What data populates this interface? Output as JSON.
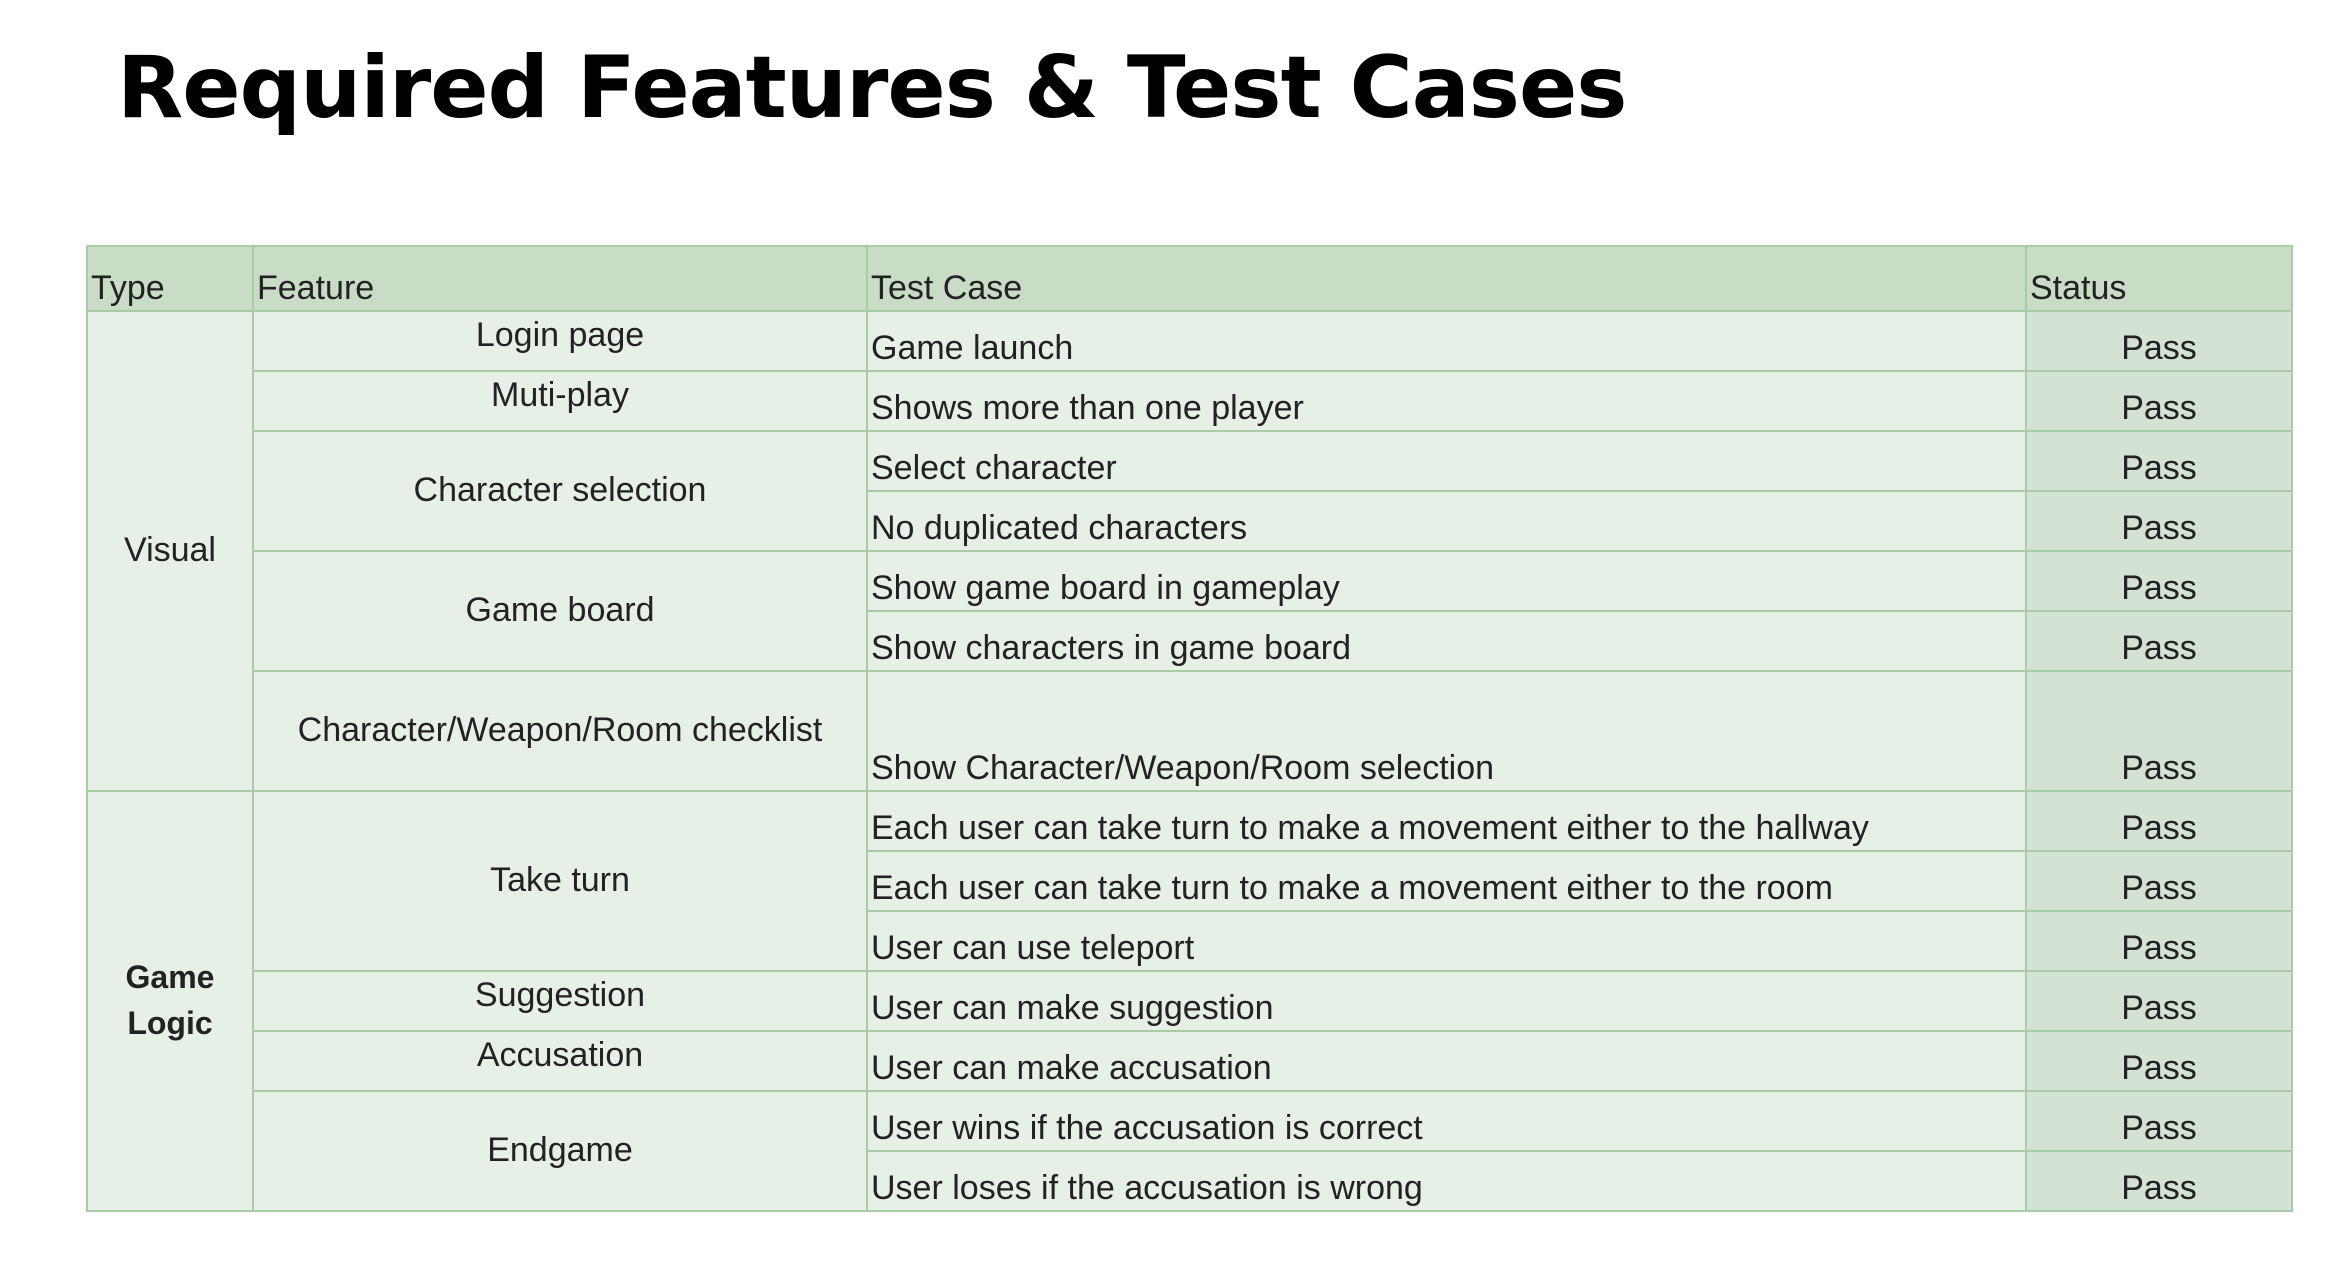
{
  "title": "Required Features & Test Cases",
  "table": {
    "headers": {
      "type": "Type",
      "feature": "Feature",
      "test_case": "Test Case",
      "status": "Status"
    },
    "types": {
      "visual": "Visual",
      "game_logic": "Game Logic"
    },
    "features": [
      "Login page",
      "Muti-play",
      "Character selection",
      "Game board",
      "Character/Weapon/Room checklist",
      "Take turn",
      "Suggestion",
      "Accusation",
      "Endgame"
    ],
    "rows": [
      {
        "test": "Game launch",
        "status": "Pass"
      },
      {
        "test": "Shows more than one player",
        "status": "Pass"
      },
      {
        "test": "Select character",
        "status": "Pass"
      },
      {
        "test": "No duplicated characters",
        "status": "Pass"
      },
      {
        "test": "Show game board in gameplay",
        "status": "Pass"
      },
      {
        "test": "Show characters in game board",
        "status": "Pass"
      },
      {
        "test": "Show Character/Weapon/Room selection",
        "status": "Pass"
      },
      {
        "test": "Each user can take turn to make a movement either to the hallway",
        "status": "Pass"
      },
      {
        "test": "Each user can take turn to make a movement either to the room",
        "status": "Pass"
      },
      {
        "test": "User can use teleport",
        "status": "Pass"
      },
      {
        "test": "User can make suggestion",
        "status": "Pass"
      },
      {
        "test": "User can make accusation",
        "status": "Pass"
      },
      {
        "test": "User wins if the accusation is correct",
        "status": "Pass"
      },
      {
        "test": "User loses if the accusation is wrong",
        "status": "Pass"
      }
    ]
  },
  "colors": {
    "header_bg": "#c9ddc6",
    "cell_bg": "#e7f0e6",
    "status_bg": "#d4e2d3",
    "border": "#a9cba5"
  }
}
